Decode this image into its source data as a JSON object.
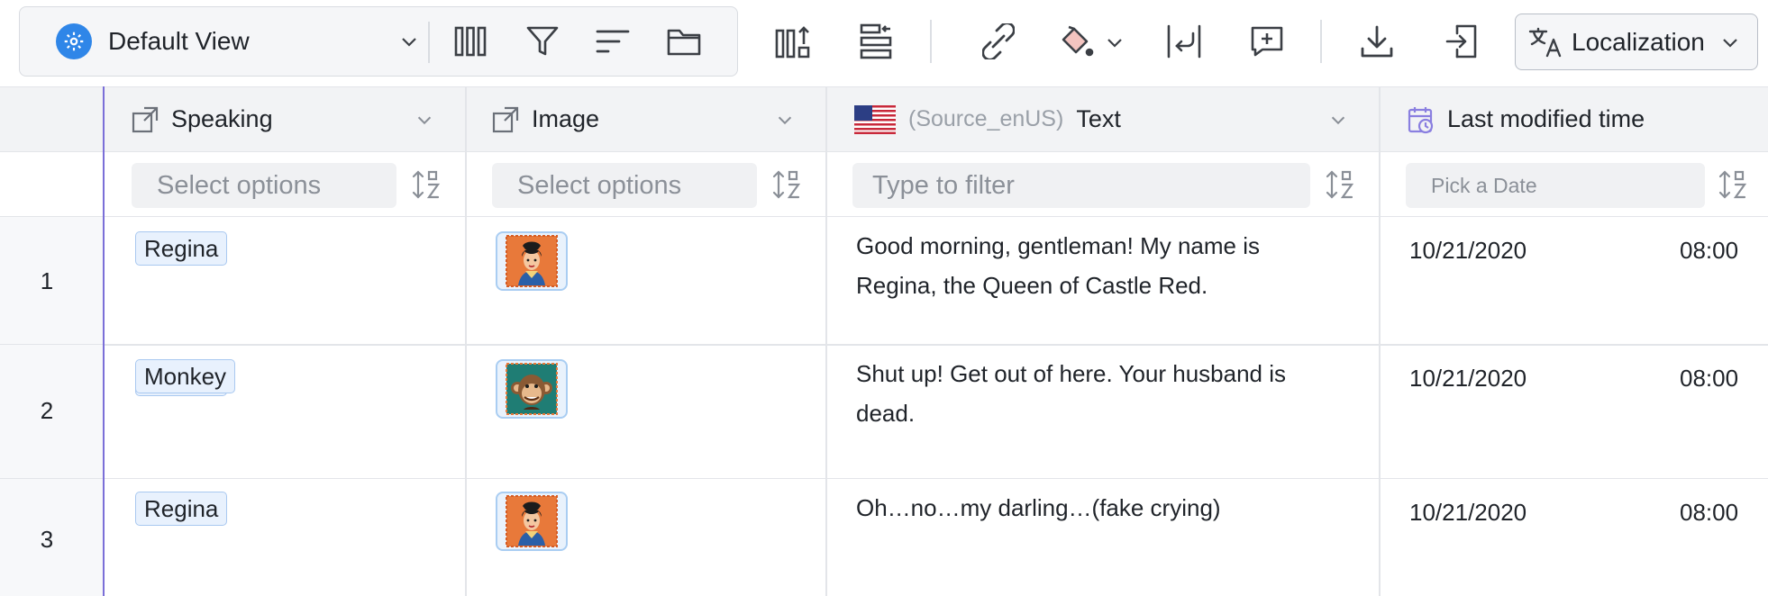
{
  "toolbar": {
    "view_name": "Default View",
    "localization_label": "Localization"
  },
  "columns": [
    {
      "title": "Speaking",
      "filter_placeholder": "Select options"
    },
    {
      "title": "Image",
      "filter_placeholder": "Select options"
    },
    {
      "title": "Text",
      "source_label": "(Source_enUS)",
      "filter_placeholder": "Type to filter"
    },
    {
      "title": "Last modified time",
      "filter_placeholder": "Pick a Date"
    }
  ],
  "rows": [
    {
      "num": "1",
      "speaker": "Regina",
      "image": "regina-avatar",
      "text": "Good morning, gentleman! My name is Regina, the Queen of Castle Red.",
      "date": "10/21/2020",
      "time": "08:00"
    },
    {
      "num": "2",
      "speaker": "Monkey",
      "image": "monkey-avatar",
      "text": "Shut up! Get out of here. Your husband is dead.",
      "date": "10/21/2020",
      "time": "08:00"
    },
    {
      "num": "3",
      "speaker": "Regina",
      "image": "regina-avatar",
      "text": "Oh…no…my darling…(fake crying)",
      "date": "10/21/2020",
      "time": "08:00"
    }
  ],
  "colors": {
    "accent": "#2f86e8",
    "selection_line": "#7b6fd8",
    "tag_bg": "#e8f1fd",
    "header_bg": "#f2f3f5"
  }
}
